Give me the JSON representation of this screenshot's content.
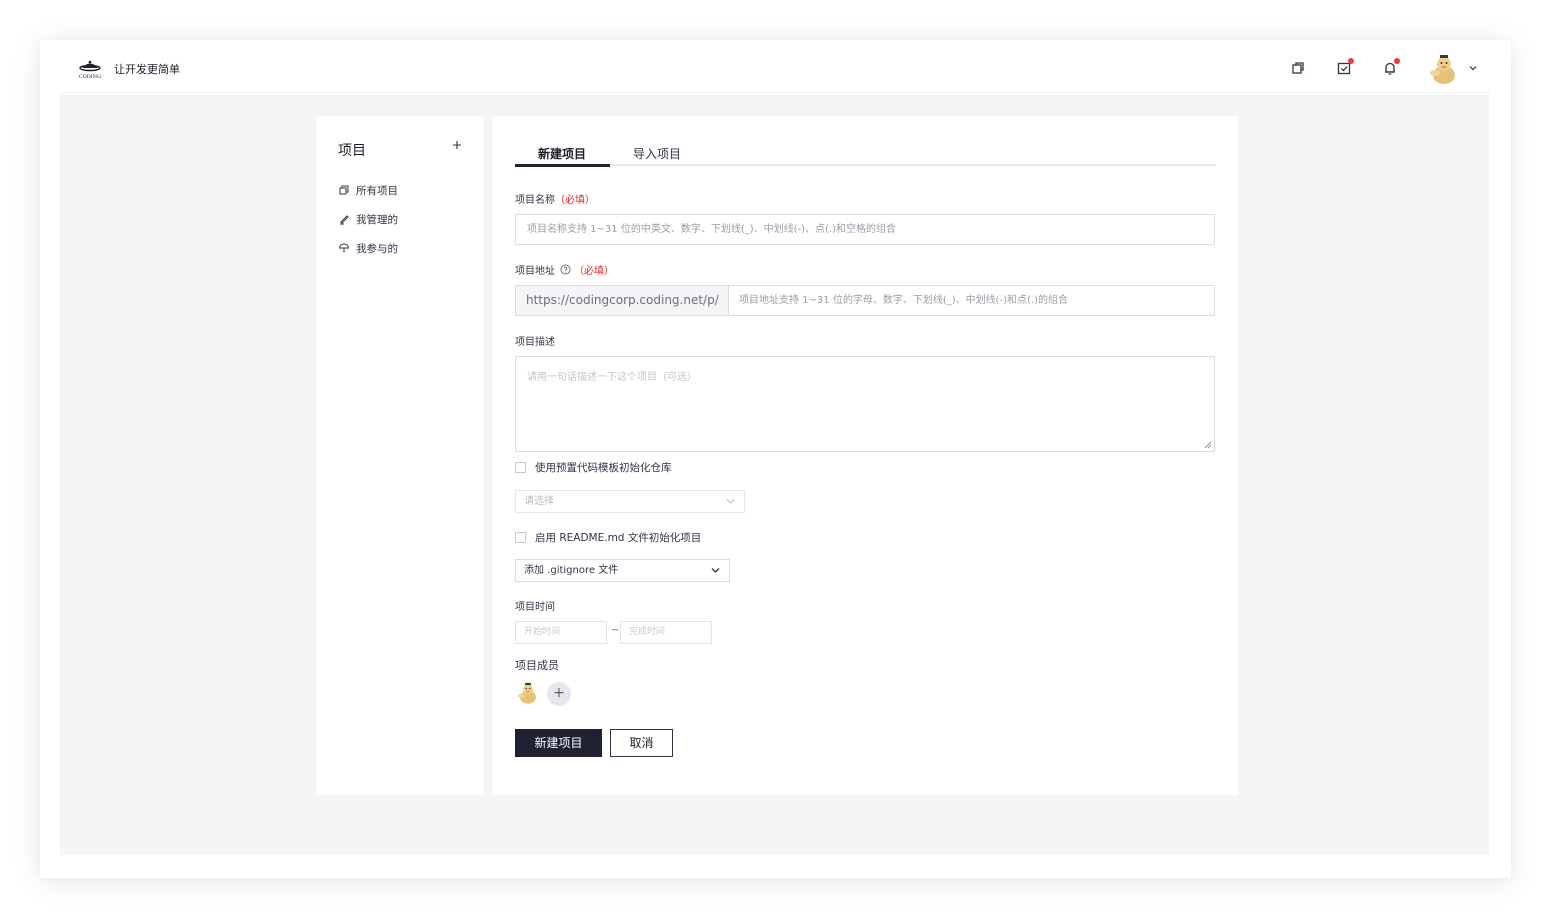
{
  "header": {
    "logo_text": "CODING",
    "slogan": "让开发更简单",
    "notification_dot_color": "#f23b3b"
  },
  "sidebar": {
    "title": "项目",
    "items": [
      {
        "label": "所有项目",
        "icon": "projects-icon"
      },
      {
        "label": "我管理的",
        "icon": "pencil-icon"
      },
      {
        "label": "我参与的",
        "icon": "umbrella-icon"
      }
    ]
  },
  "tabs": [
    {
      "label": "新建项目",
      "active": true
    },
    {
      "label": "导入项目",
      "active": false
    }
  ],
  "form": {
    "name_label": "项目名称",
    "required_mark": "（必填）",
    "name_placeholder": "项目名称支持 1~31 位的中英文、数字、下划线(_)、中划线(-)、点(.)和空格的组合",
    "address_label": "项目地址",
    "address_prefix": "https://codingcorp.coding.net/p/",
    "address_placeholder": "项目地址支持 1~31 位的字母、数字、下划线(_)、中划线(-)和点(.)的组合",
    "desc_label": "项目描述",
    "desc_placeholder": "请用一句话描述一下这个项目（可选）",
    "template_checkbox": "使用预置代码模板初始化仓库",
    "template_select_placeholder": "请选择",
    "readme_checkbox": "启用 README.md 文件初始化项目",
    "gitignore_select": "添加 .gitignore 文件",
    "time_label": "项目时间",
    "start_placeholder": "开始时间",
    "date_separator": "~",
    "end_placeholder": "完成时间",
    "members_label": "项目成员",
    "add_member": "+",
    "submit": "新建项目",
    "cancel": "取消"
  },
  "colors": {
    "primary": "#1e2232",
    "canvas_bg": "#f4f5f7",
    "required": "#e02d2d"
  }
}
